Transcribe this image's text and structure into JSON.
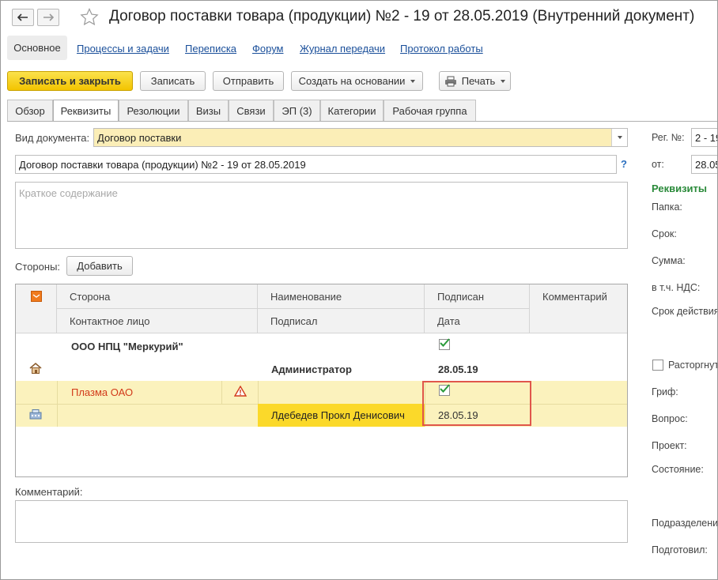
{
  "window": {
    "title": "Договор поставки товара (продукции) №2 - 19 от 28.05.2019 (Внутренний документ)"
  },
  "sections": {
    "active": "Основное",
    "links": [
      "Процессы и задачи",
      "Переписка",
      "Форум",
      "Журнал передачи",
      "Протокол работы"
    ]
  },
  "toolbar": {
    "save_close": "Записать и закрыть",
    "save": "Записать",
    "send": "Отправить",
    "create_based": "Создать на основании",
    "print": "Печать"
  },
  "tabs": [
    "Обзор",
    "Реквизиты",
    "Резолюции",
    "Визы",
    "Связи",
    "ЭП (3)",
    "Категории",
    "Рабочая группа"
  ],
  "form": {
    "doc_type_label": "Вид документа:",
    "doc_type_value": "Договор поставки",
    "name_value": "Договор поставки товара (продукции) №2 - 19 от 28.05.2019",
    "help": "?",
    "summary_placeholder": "Краткое содержание",
    "parties_label": "Стороны:",
    "add_button": "Добавить",
    "comment_label": "Комментарий:"
  },
  "table": {
    "headers": {
      "party": "Сторона",
      "name": "Наименование",
      "signed": "Подписан",
      "comment": "Комментарий",
      "contact": "Контактное лицо",
      "signed_by": "Подписал",
      "date": "Дата"
    },
    "rows": [
      {
        "party": "ООО НПЦ \"Меркурий\"",
        "signed_by": "Администратор",
        "date": "28.05.19",
        "signed": true
      },
      {
        "party": "Плазма ОАО",
        "signed_by": "Лдебедев Прокл Денисович",
        "date": "28.05.19",
        "signed": true
      }
    ]
  },
  "right_panel": {
    "reg_label": "Рег. №:",
    "reg_value": "2 - 19",
    "from_label": "от:",
    "from_value": "28.05",
    "section_title": "Реквизиты",
    "labels": [
      "Папка:",
      "Срок:",
      "Сумма:",
      "в т.ч. НДС:",
      "Срок действия"
    ],
    "terminated": "Расторгнут",
    "labels2": [
      "Гриф:",
      "Вопрос:",
      "Проект:",
      "Состояние:"
    ],
    "labels3": [
      "Подразделение",
      "Подготовил:"
    ],
    "colors": {
      "section_title": "#2a8a3a"
    }
  },
  "colors": {
    "primary_button": "#f3c400",
    "link": "#1a4f9a",
    "highlight_row": "#fbf2bd",
    "selected_cell": "#fbd92a",
    "warning_red": "#d23a1a",
    "annotation_box": "#e0564b"
  }
}
